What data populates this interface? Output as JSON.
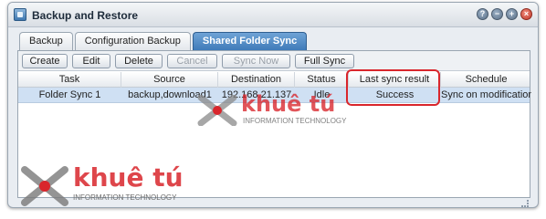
{
  "window": {
    "title": "Backup and Restore",
    "controls": [
      "?",
      "−",
      "+",
      "×"
    ]
  },
  "tabs": [
    {
      "label": "Backup",
      "active": false
    },
    {
      "label": "Configuration Backup",
      "active": false
    },
    {
      "label": "Shared Folder Sync",
      "active": true
    }
  ],
  "toolbar": {
    "create": "Create",
    "edit": "Edit",
    "delete": "Delete",
    "cancel": "Cancel",
    "sync_now": "Sync Now",
    "full_sync": "Full Sync"
  },
  "table": {
    "columns": [
      "Task",
      "Source",
      "Destination",
      "Status",
      "Last sync result",
      "Schedule"
    ],
    "rows": [
      [
        "Folder Sync 1",
        "backup,download1",
        "192.168.21.137",
        "Idle",
        "Success",
        "Sync on modification"
      ]
    ]
  },
  "watermark": {
    "name": "khuê tú",
    "subtitle": "INFORMATION TECHNOLOGY"
  },
  "colors": {
    "accent": "#3f7bb9",
    "highlight": "#d9262c",
    "row_selected": "#cfe0f3"
  }
}
